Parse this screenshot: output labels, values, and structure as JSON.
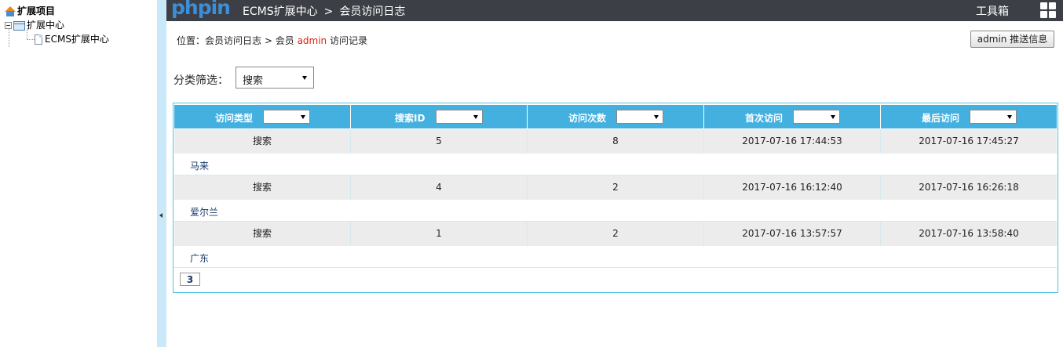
{
  "sidebar": {
    "root_label": "扩展项目",
    "node_label": "扩展中心",
    "child_label": "ECMS扩展中心"
  },
  "topbar": {
    "logo_part1": "php",
    "logo_part2": "in",
    "crumb_1": "ECMS扩展中心",
    "crumb_sep": ">",
    "crumb_2": "会员访问日志",
    "toolbox": "工具箱"
  },
  "position": {
    "prefix": "位置：",
    "link_1": "会员访问日志",
    "sep": " > ",
    "member_text": "会员",
    "member_name": "admin",
    "suffix": "访问记录"
  },
  "push_button": "admin 推送信息",
  "filter": {
    "label": "分类筛选：",
    "selected": "搜索"
  },
  "table": {
    "headers": [
      "访问类型",
      "搜索ID",
      "访问次数",
      "首次访问",
      "最后访问"
    ],
    "rows": [
      {
        "cells": [
          "搜索",
          "5",
          "8",
          "2017-07-16 17:44:53",
          "2017-07-16 17:45:27"
        ],
        "note": "马来"
      },
      {
        "cells": [
          "搜索",
          "4",
          "2",
          "2017-07-16 16:12:40",
          "2017-07-16 16:26:18"
        ],
        "note": "爱尔兰"
      },
      {
        "cells": [
          "搜索",
          "1",
          "2",
          "2017-07-16 13:57:57",
          "2017-07-16 13:58:40"
        ],
        "note": "广东"
      }
    ]
  },
  "pager": {
    "current": "3"
  }
}
